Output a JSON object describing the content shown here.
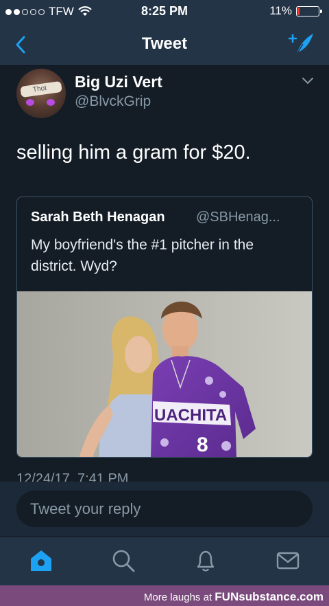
{
  "status_bar": {
    "carrier": "TFW",
    "time": "8:25 PM",
    "battery": "11%",
    "battery_level": 0.11
  },
  "nav": {
    "title": "Tweet"
  },
  "tweet": {
    "author_name": "Big Uzi Vert",
    "author_handle": "@BlvckGrip",
    "avatar_text": "Thot",
    "text": "selling him a gram for $20.",
    "timestamp": "12/24/17, 7:41 PM"
  },
  "quoted_tweet": {
    "author_name": "Sarah Beth Henagan",
    "author_handle": "@SBHenag...",
    "text": "My boyfriend's the #1 pitcher in the district. Wyd?",
    "jersey_text": "UACHITA",
    "jersey_number": "8"
  },
  "reply": {
    "placeholder": "Tweet your reply"
  },
  "tabs": [
    {
      "icon": "home-icon",
      "active": true
    },
    {
      "icon": "search-icon",
      "active": false
    },
    {
      "icon": "bell-icon",
      "active": false
    },
    {
      "icon": "mail-icon",
      "active": false
    }
  ],
  "footer": {
    "prefix": "More laughs at",
    "brand": "FUNsubstance.com"
  },
  "colors": {
    "background": "#141d26",
    "bar": "#243447",
    "accent": "#1da1f2",
    "muted": "#8899a6"
  }
}
